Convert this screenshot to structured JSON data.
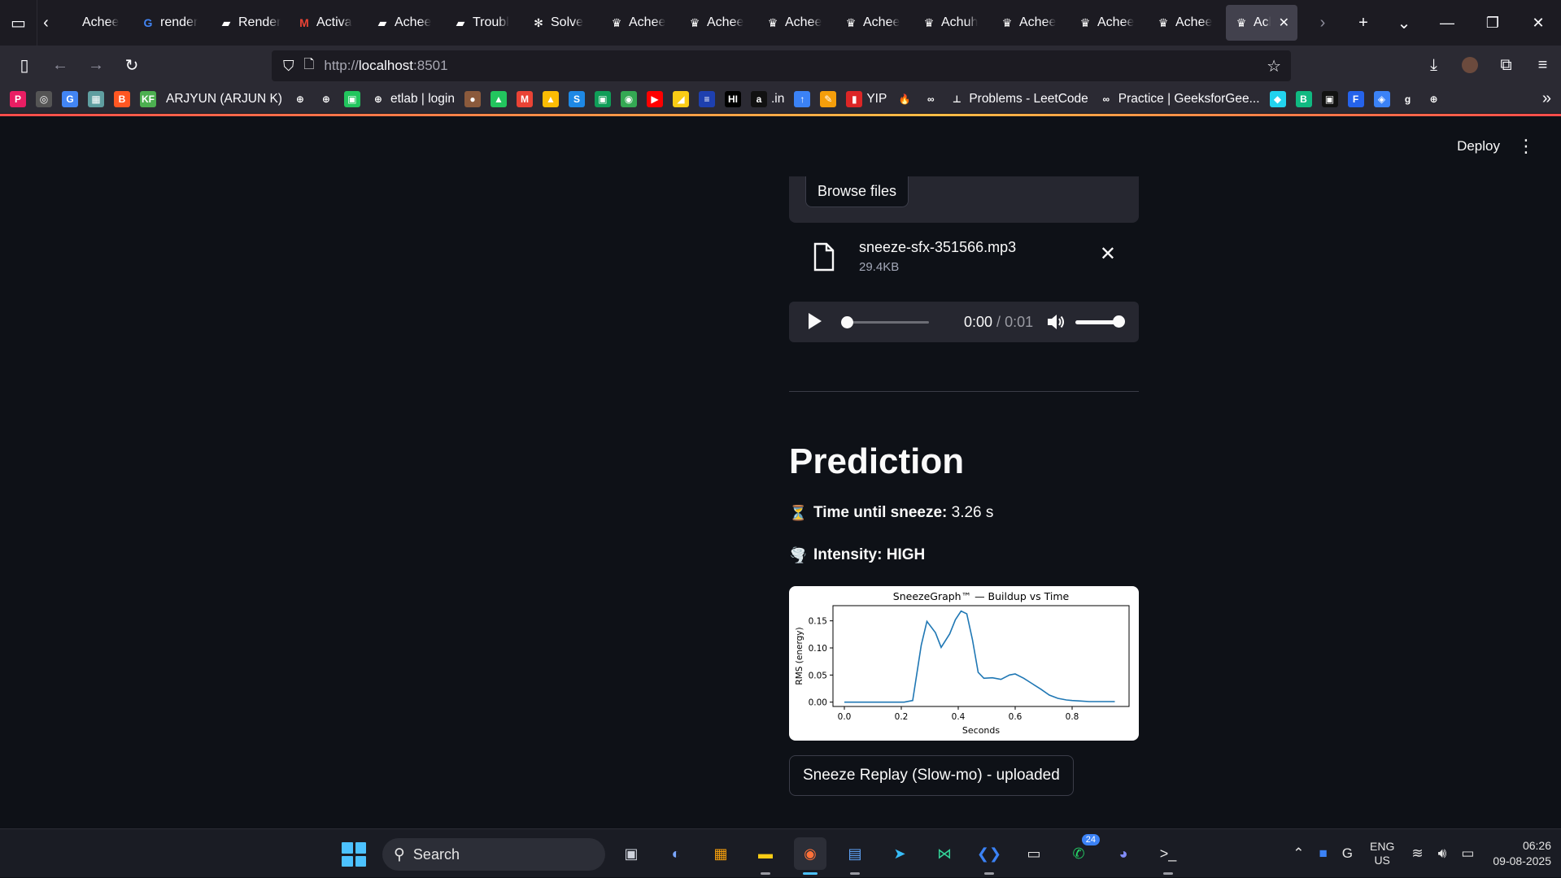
{
  "browser": {
    "tabs": [
      {
        "title": "Achee",
        "favicon": "back-chevron",
        "color": "#fbfbfe"
      },
      {
        "title": "render",
        "favicon": "G",
        "color": "#4285f4"
      },
      {
        "title": "Render",
        "favicon": "render-icon",
        "color": "#ffffff"
      },
      {
        "title": "Activa",
        "favicon": "M",
        "color": "#ea4335"
      },
      {
        "title": "Achee",
        "favicon": "render-icon",
        "color": "#ffffff"
      },
      {
        "title": "Troubl",
        "favicon": "render-icon",
        "color": "#ffffff"
      },
      {
        "title": "Solve",
        "favicon": "chatgpt-icon",
        "color": "#ffffff"
      },
      {
        "title": "Achee",
        "favicon": "crown-icon",
        "color": "#ffffff"
      },
      {
        "title": "Achee",
        "favicon": "crown-icon",
        "color": "#ffffff"
      },
      {
        "title": "Achee",
        "favicon": "crown-icon",
        "color": "#ffffff"
      },
      {
        "title": "Achee",
        "favicon": "crown-icon",
        "color": "#ffffff"
      },
      {
        "title": "Achuh",
        "favicon": "crown-icon",
        "color": "#ffffff"
      },
      {
        "title": "Achee",
        "favicon": "crown-icon",
        "color": "#ffffff"
      },
      {
        "title": "Achee",
        "favicon": "crown-icon",
        "color": "#ffffff"
      },
      {
        "title": "Achee",
        "favicon": "crown-icon",
        "color": "#ffffff"
      },
      {
        "title": "Ach",
        "favicon": "crown-icon",
        "color": "#ffffff",
        "active": true
      }
    ],
    "url_scheme": "http://",
    "url_host": "localhost",
    "url_port": ":8501",
    "bookmarks": [
      {
        "label": "",
        "icon": "P",
        "color": "#e91e63"
      },
      {
        "label": "",
        "icon": "◎",
        "color": "#555"
      },
      {
        "label": "",
        "icon": "G",
        "color": "#4285f4"
      },
      {
        "label": "",
        "icon": "▦",
        "color": "#5f9ea0"
      },
      {
        "label": "",
        "icon": "B",
        "color": "#ff5722"
      },
      {
        "label": "",
        "icon": "KF",
        "color": "#4caf50"
      },
      {
        "label": "ARJYUN (ARJUN K)",
        "icon": "",
        "color": "#2b2a33"
      },
      {
        "label": "",
        "icon": "⊕",
        "color": "#2b2a33"
      },
      {
        "label": "",
        "icon": "⊕",
        "color": "#2b2a33"
      },
      {
        "label": "",
        "icon": "▣",
        "color": "#22c55e"
      },
      {
        "label": "etlab | login",
        "icon": "⊕",
        "color": "#2b2a33"
      },
      {
        "label": "",
        "icon": "●",
        "color": "#8b5a3c"
      },
      {
        "label": "",
        "icon": "▲",
        "color": "#22c55e"
      },
      {
        "label": "",
        "icon": "M",
        "color": "#ea4335"
      },
      {
        "label": "",
        "icon": "▲",
        "color": "#fbbc04"
      },
      {
        "label": "",
        "icon": "S",
        "color": "#1e88e5"
      },
      {
        "label": "",
        "icon": "▣",
        "color": "#0f9d58"
      },
      {
        "label": "",
        "icon": "◉",
        "color": "#34a853"
      },
      {
        "label": "",
        "icon": "▶",
        "color": "#ff0000"
      },
      {
        "label": "",
        "icon": "◢",
        "color": "#facc15"
      },
      {
        "label": "",
        "icon": "≡",
        "color": "#1e40af"
      },
      {
        "label": "",
        "icon": "HI",
        "color": "#000000"
      },
      {
        "label": ".in",
        "icon": "a",
        "color": "#111111"
      },
      {
        "label": "",
        "icon": "↑",
        "color": "#3b82f6"
      },
      {
        "label": "",
        "icon": "✎",
        "color": "#f59e0b"
      },
      {
        "label": "YIP",
        "icon": "▮",
        "color": "#dc2626"
      },
      {
        "label": "",
        "icon": "🔥",
        "color": "#2b2a33"
      },
      {
        "label": "",
        "icon": "∞",
        "color": "#2b2a33"
      },
      {
        "label": "Problems - LeetCode",
        "icon": "⊥",
        "color": "#2b2a33"
      },
      {
        "label": "Practice | GeeksforGee...",
        "icon": "∞",
        "color": "#2b2a33"
      },
      {
        "label": "",
        "icon": "◆",
        "color": "#22d3ee"
      },
      {
        "label": "",
        "icon": "B",
        "color": "#10b981"
      },
      {
        "label": "",
        "icon": "▣",
        "color": "#111111"
      },
      {
        "label": "",
        "icon": "F",
        "color": "#2563eb"
      },
      {
        "label": "",
        "icon": "◈",
        "color": "#3b82f6"
      },
      {
        "label": "",
        "icon": "g",
        "color": "#2b2a33"
      },
      {
        "label": "",
        "icon": "⊕",
        "color": "#2b2a33"
      }
    ]
  },
  "app": {
    "deploy_label": "Deploy",
    "browse_label": "Browse files",
    "file_name": "sneeze-sfx-351566.mp3",
    "file_size": "29.4KB",
    "audio_current": "0:00",
    "audio_sep": " / ",
    "audio_duration": "0:01",
    "audio_progress": 0.0,
    "volume_level": 1.0,
    "section_title": "Prediction",
    "time_emoji": "⏳",
    "time_label": "Time until sneeze:",
    "time_value": "3.26 s",
    "intensity_emoji": "🌪️",
    "intensity_label": "Intensity: HIGH",
    "replay_label": "Sneeze Replay (Slow-mo) - uploaded"
  },
  "chart_data": {
    "type": "line",
    "title": "SneezeGraph™ — Buildup vs Time",
    "xlabel": "Seconds",
    "ylabel": "RMS (energy)",
    "xlim": [
      -0.04,
      1.0
    ],
    "ylim": [
      -0.008,
      0.178
    ],
    "xticks": [
      "0.0",
      "0.2",
      "0.4",
      "0.6",
      "0.8"
    ],
    "yticks": [
      "0.00",
      "0.05",
      "0.10",
      "0.15"
    ],
    "grid": false,
    "series": [
      {
        "color": "#1f77b4",
        "x": [
          0.0,
          0.03,
          0.06,
          0.09,
          0.12,
          0.15,
          0.18,
          0.21,
          0.24,
          0.27,
          0.29,
          0.32,
          0.34,
          0.37,
          0.39,
          0.41,
          0.43,
          0.45,
          0.47,
          0.49,
          0.52,
          0.55,
          0.58,
          0.6,
          0.63,
          0.66,
          0.69,
          0.72,
          0.75,
          0.78,
          0.8,
          0.83,
          0.86,
          0.89,
          0.92,
          0.95
        ],
        "y": [
          0.0,
          0.0,
          0.0,
          0.0,
          0.0,
          0.0,
          0.0,
          0.0,
          0.003,
          0.105,
          0.149,
          0.128,
          0.101,
          0.126,
          0.152,
          0.168,
          0.163,
          0.115,
          0.055,
          0.044,
          0.045,
          0.042,
          0.05,
          0.052,
          0.044,
          0.034,
          0.024,
          0.013,
          0.007,
          0.004,
          0.003,
          0.002,
          0.001,
          0.001,
          0.001,
          0.001
        ]
      }
    ]
  },
  "taskbar": {
    "search_label": "Search",
    "whatsapp_badge": "24",
    "lang_top": "ENG",
    "lang_bottom": "US",
    "time": "06:26",
    "date": "09-08-2025"
  }
}
